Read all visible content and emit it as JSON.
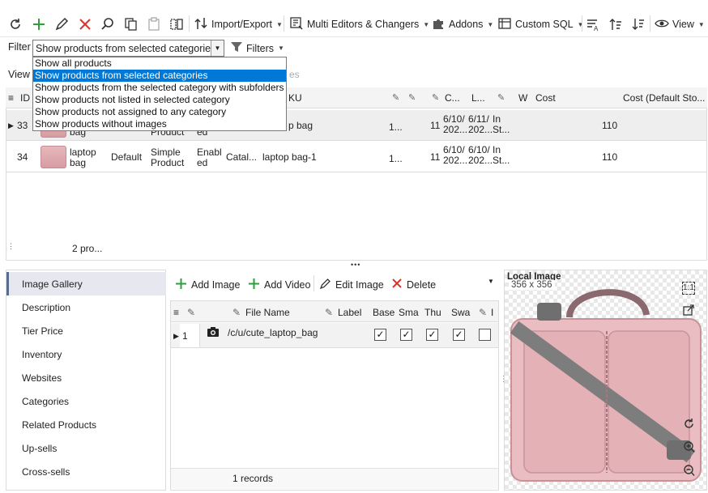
{
  "toolbar": {
    "import_export": "Import/Export",
    "multi_editors": "Multi Editors & Changers",
    "addons": "Addons",
    "custom_sql": "Custom SQL",
    "view": "View"
  },
  "filter": {
    "label": "Filter",
    "selected": "Show products from selected categories",
    "filters_button": "Filters",
    "options": [
      "Show all products",
      "Show products from selected categories",
      "Show products from the selected category with subfolders",
      "Show products not listed in selected category",
      "Show products not assigned to any category",
      "Show products without images"
    ]
  },
  "view_row": {
    "label": "View",
    "tail": "es"
  },
  "grid": {
    "headers": {
      "id": "ID",
      "sku": "KU",
      "c": "C...",
      "l": "L...",
      "w": "W",
      "cost": "Cost",
      "cost_default": "Cost (Default Sto..."
    },
    "rows": [
      {
        "id": "33",
        "name_partial": "bag",
        "type_partial": "Product",
        "status_partial": "ed",
        "sku_partial": "p bag",
        "num": "1...",
        "qty": "11",
        "created": "6/10/\n202...",
        "updated": "6/11/\n202...",
        "stock": "In\nSt...",
        "cost": "110"
      },
      {
        "id": "34",
        "name": "laptop\nbag",
        "attr_set": "Default",
        "type": "Simple\nProduct",
        "status": "Enabl\ned",
        "visibility": "Catal...",
        "sku": "laptop bag-1",
        "num": "1...",
        "qty": "11",
        "created": "6/10/\n202...",
        "updated": "6/10/\n202...",
        "stock": "In\nSt...",
        "cost": "110"
      }
    ],
    "footer": "2 pro..."
  },
  "sidenav": {
    "items": [
      "Image Gallery",
      "Description",
      "Tier Price",
      "Inventory",
      "Websites",
      "Categories",
      "Related Products",
      "Up-sells",
      "Cross-sells"
    ],
    "active_index": 0
  },
  "images": {
    "toolbar": {
      "add_image": "Add Image",
      "add_video": "Add Video",
      "edit_image": "Edit Image",
      "delete": "Delete"
    },
    "headers": {
      "file_name": "File Name",
      "label": "Label",
      "base": "Base",
      "small": "Sma",
      "thumb": "Thu",
      "swatch": "Swa",
      "i": "I"
    },
    "rows": [
      {
        "pos": "1",
        "file": "/c/u/cute_laptop_bag",
        "base": true,
        "small": true,
        "thumb": true,
        "swatch": true,
        "excluded": false
      }
    ],
    "footer": "1 records"
  },
  "local_image": {
    "title": "Local Image",
    "size": "356 x 356"
  },
  "colors": {
    "accent": "#0078d7",
    "add_green": "#2e9e3e",
    "delete_red": "#d9332b",
    "bag_pink": "#e6b8bc"
  }
}
